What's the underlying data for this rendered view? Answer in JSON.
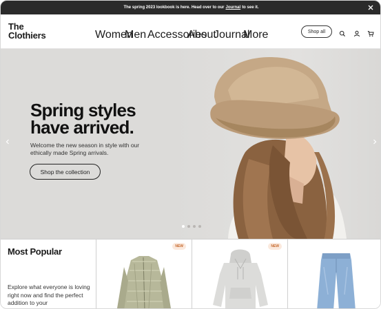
{
  "announcement": {
    "text_before": "The spring 2023 lookbook is here. Head over to our",
    "link_text": "Journal",
    "text_after": "to see it.",
    "close_icon": "close-icon"
  },
  "brand": {
    "line1": "The",
    "line2": "Clothiers"
  },
  "nav": {
    "items": [
      {
        "label": "Women"
      },
      {
        "label": "Men"
      },
      {
        "label": "Accessories"
      },
      {
        "label": "About"
      },
      {
        "label": "Journal"
      },
      {
        "label": "More"
      }
    ],
    "shop_all": "Shop all",
    "icons": [
      "search-icon",
      "account-icon",
      "cart-icon"
    ]
  },
  "hero": {
    "title_line1": "Spring styles",
    "title_line2": "have arrived.",
    "subtitle": "Welcome the new season in style with our ethically made Spring arrivals.",
    "cta": "Shop the collection",
    "prev_icon": "chevron-left-icon",
    "next_icon": "chevron-right-icon",
    "slide_count": 4,
    "active_slide": 1
  },
  "collection": {
    "title": "Most Popular",
    "description": "Explore what everyone is loving right now and find the perfect addition to your",
    "products": [
      {
        "image": "quilted-jacket-image",
        "badge": "NEW"
      },
      {
        "image": "grey-hoodie-image",
        "badge": "NEW"
      },
      {
        "image": "blue-jeans-image",
        "badge": ""
      }
    ]
  },
  "colors": {
    "announcement_bg": "#2b2b2b",
    "hero_bg": "#dcdbd9",
    "badge_bg": "#fbe9dd",
    "badge_text": "#c66a2e"
  }
}
